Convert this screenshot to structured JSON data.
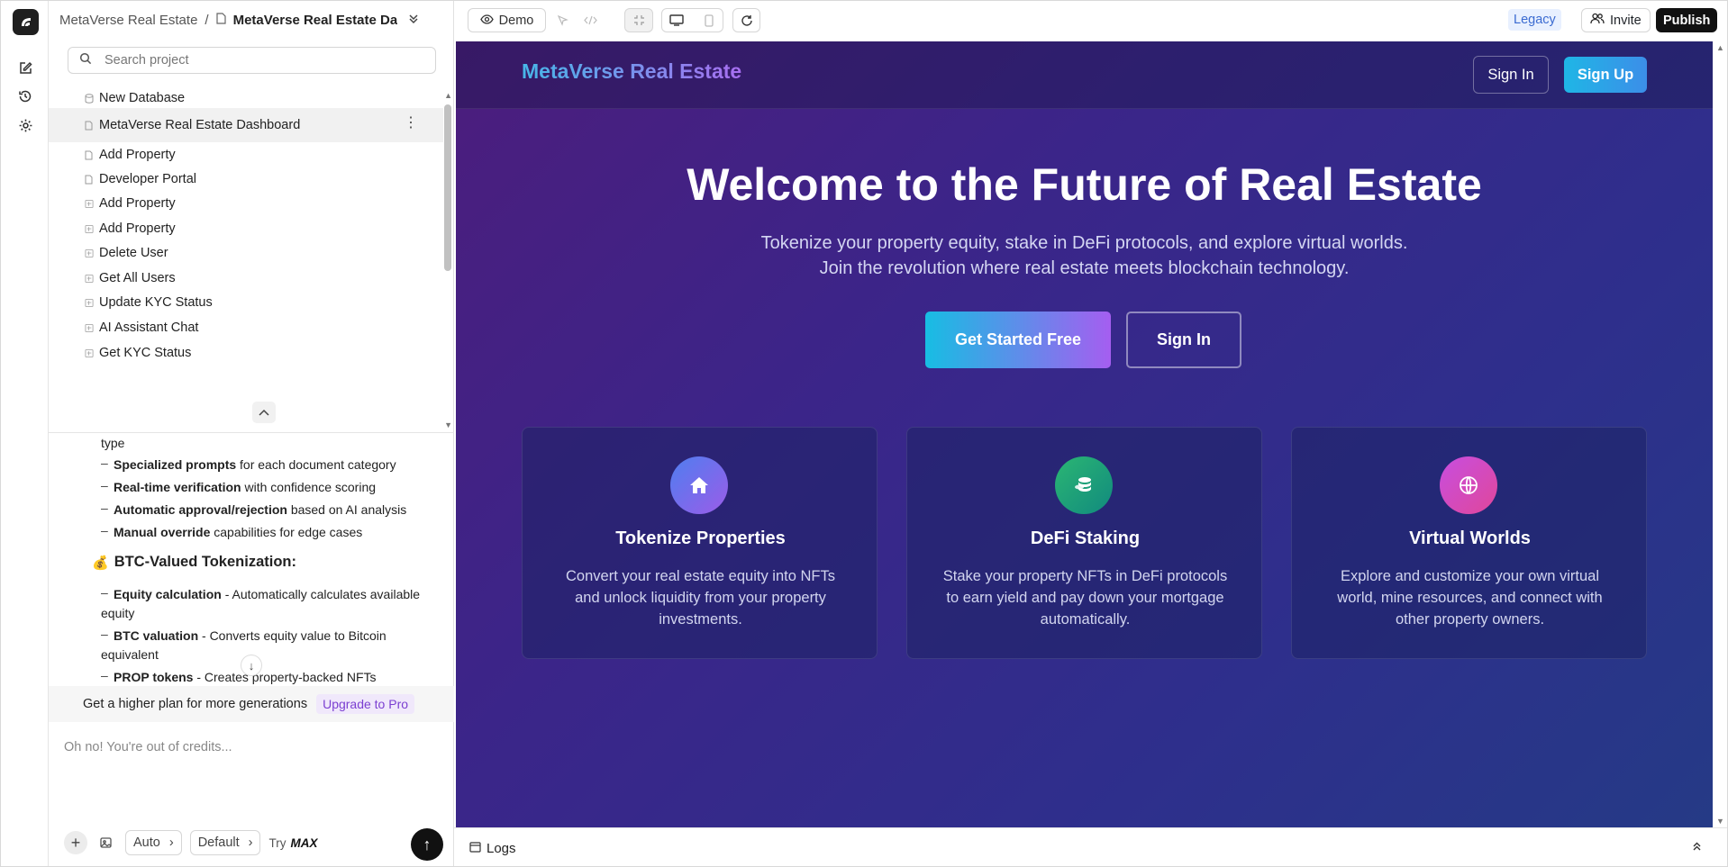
{
  "breadcrumb": {
    "project": "MetaVerse Real Estate",
    "separator": "/",
    "page": "MetaVerse Real Estate Da"
  },
  "search": {
    "placeholder": "Search project"
  },
  "tree": [
    {
      "label": "New Database",
      "icon": "database-icon"
    },
    {
      "label": "MetaVerse Real Estate Dashboard",
      "icon": "file-icon",
      "selected": true
    },
    {
      "label": "Add Property",
      "icon": "file-icon"
    },
    {
      "label": "Developer Portal",
      "icon": "file-icon"
    },
    {
      "label": "Add Property",
      "icon": "function-icon"
    },
    {
      "label": "Add Property",
      "icon": "function-icon"
    },
    {
      "label": "Delete User",
      "icon": "function-icon"
    },
    {
      "label": "Get All Users",
      "icon": "function-icon"
    },
    {
      "label": "Update KYC Status",
      "icon": "function-icon"
    },
    {
      "label": "AI Assistant Chat",
      "icon": "function-icon"
    },
    {
      "label": "Get KYC Status",
      "icon": "function-icon"
    }
  ],
  "chat": {
    "type_word": "type",
    "bullets1": [
      {
        "bold": "Specialized prompts",
        "rest": " for each document category"
      },
      {
        "bold": "Real-time verification",
        "rest": " with confidence scoring"
      },
      {
        "bold": "Automatic approval/rejection",
        "rest": " based on AI analysis"
      },
      {
        "bold": "Manual override",
        "rest": " capabilities for edge cases"
      }
    ],
    "heading": "BTC-Valued Tokenization:",
    "bullets2": [
      {
        "bold": "Equity calculation",
        "rest": " - Automatically calculates available equity"
      },
      {
        "bold": "BTC valuation",
        "rest": " - Converts equity value to Bitcoin equivalent"
      },
      {
        "bold": "PROP tokens",
        "rest": " - Creates property-backed NFTs"
      }
    ]
  },
  "upsell": {
    "text": "Get a higher plan for more generations",
    "link": "Upgrade to Pro"
  },
  "composer": {
    "placeholder": "Oh no! You're out of credits...",
    "mode": "Auto",
    "model": "Default",
    "try_label": "Try",
    "try_brand": "MAX"
  },
  "topbar": {
    "demo": "Demo",
    "legacy": "Legacy",
    "invite": "Invite",
    "publish": "Publish"
  },
  "preview": {
    "brand": "MetaVerse Real Estate",
    "sign_in": "Sign In",
    "sign_up": "Sign Up",
    "hero_title": "Welcome to the Future of Real Estate",
    "hero_sub": "Tokenize your property equity, stake in DeFi protocols, and explore virtual worlds. Join the revolution where real estate meets blockchain technology.",
    "cta_primary": "Get Started Free",
    "cta_secondary": "Sign In",
    "cards": [
      {
        "title": "Tokenize Properties",
        "desc": "Convert your real estate equity into NFTs and unlock liquidity from your property investments.",
        "icon": "home-icon",
        "color": "#6d5ce8"
      },
      {
        "title": "DeFi Staking",
        "desc": "Stake your property NFTs in DeFi protocols to earn yield and pay down your mortgage automatically.",
        "icon": "coins-icon",
        "color": "#1fa37a"
      },
      {
        "title": "Virtual Worlds",
        "desc": "Explore and customize your own virtual world, mine resources, and connect with other property owners.",
        "icon": "globe-icon",
        "color": "#b43fd6"
      }
    ]
  },
  "logs": {
    "label": "Logs"
  }
}
